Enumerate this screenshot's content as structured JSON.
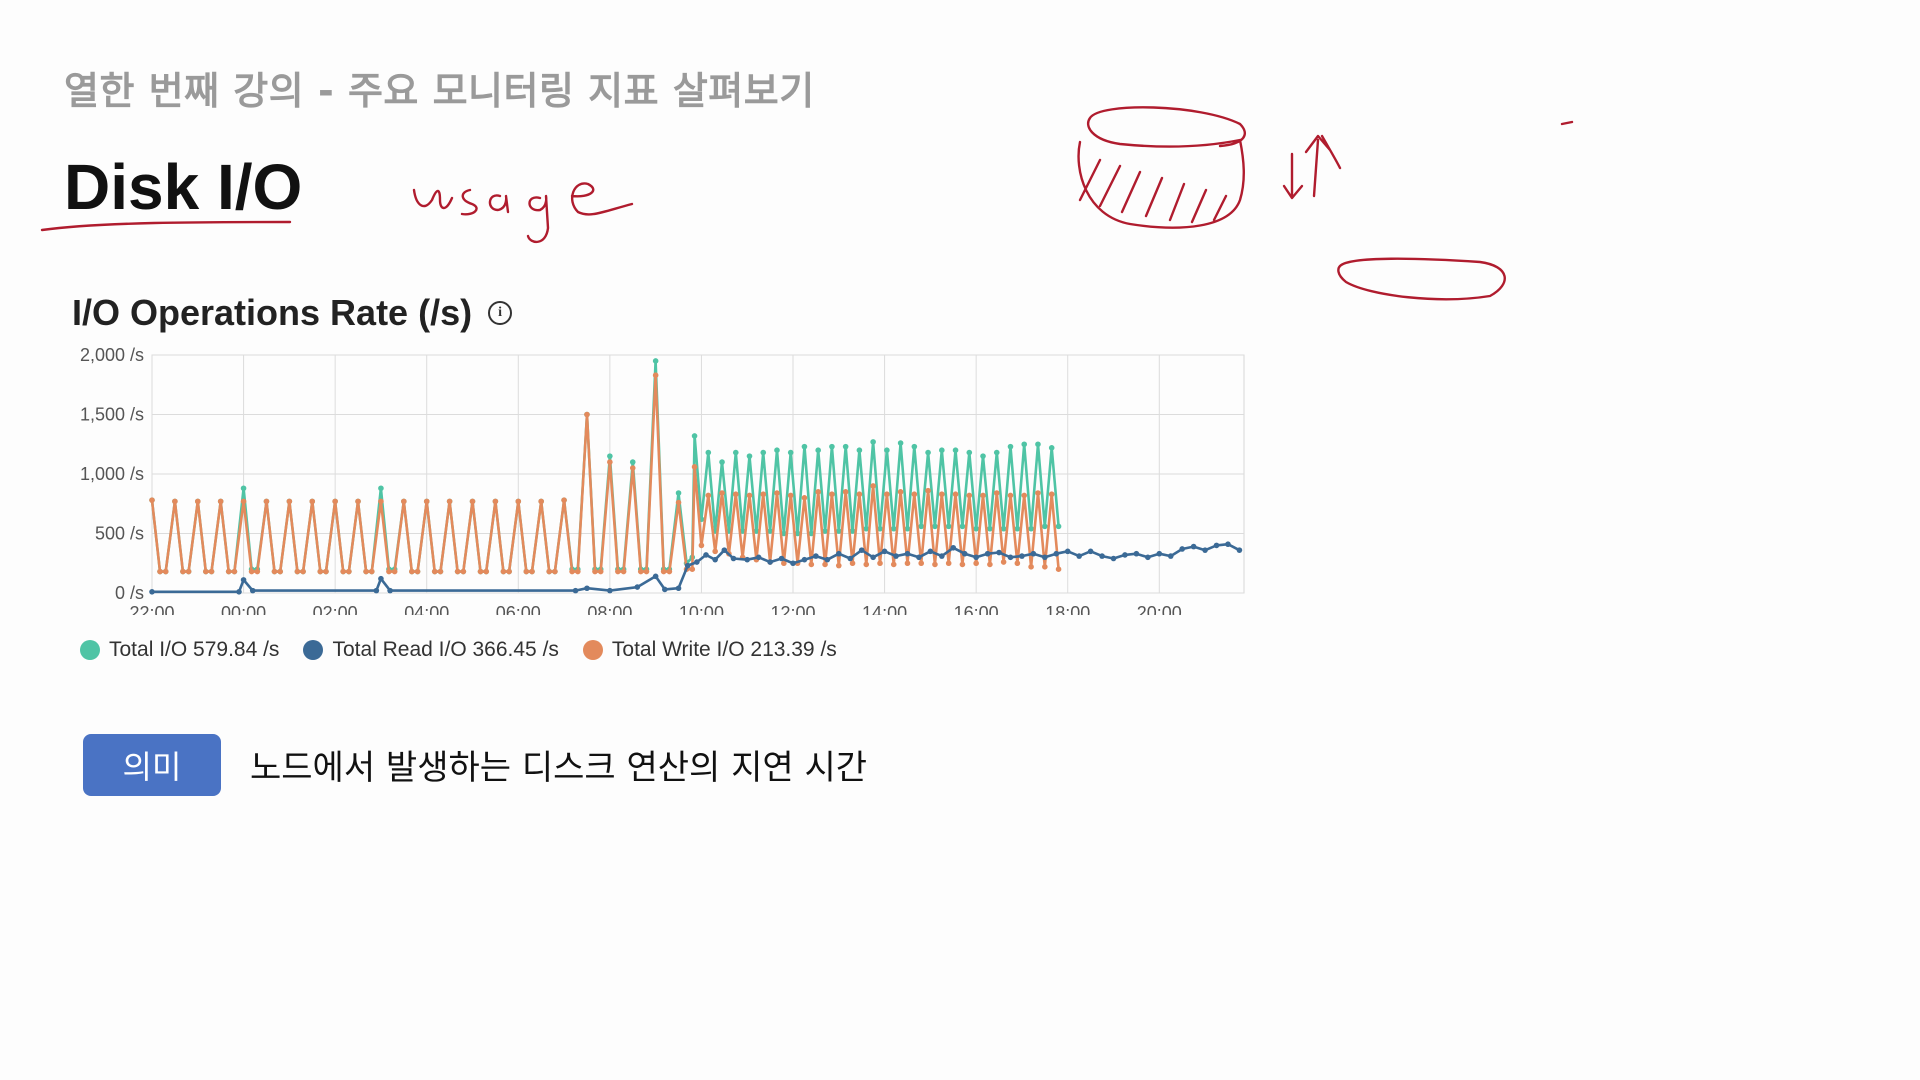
{
  "lecture": {
    "title": "열한 번째 강의 - 주요 모니터링 지표 살펴보기"
  },
  "section": {
    "title": "Disk I/O"
  },
  "meaning": {
    "badge": "의미",
    "text": "노드에서 발생하는 디스크 연산의 지연 시간"
  },
  "info_icon": "info-icon",
  "chart_data": {
    "type": "line",
    "title": "I/O Operations Rate (/s)",
    "x_tick_labels": [
      "22:00",
      "00:00",
      "02:00",
      "04:00",
      "06:00",
      "08:00",
      "10:00",
      "12:00",
      "14:00",
      "16:00",
      "18:00",
      "20:00"
    ],
    "y_tick_labels": [
      "0 /s",
      "500 /s",
      "1,000 /s",
      "1,500 /s",
      "2,000 /s"
    ],
    "ylim": [
      0,
      2000
    ],
    "x_range_hours": [
      0,
      24
    ],
    "grid": true,
    "legend_position": "bottom-left",
    "series": [
      {
        "name": "Total I/O",
        "legend_label": "Total I/O 579.84 /s",
        "color": "#4fc4a5",
        "points": [
          [
            0,
            780
          ],
          [
            0.35,
            180
          ],
          [
            0.6,
            180
          ],
          [
            1.0,
            770
          ],
          [
            1.35,
            180
          ],
          [
            1.6,
            180
          ],
          [
            2.0,
            770
          ],
          [
            2.35,
            180
          ],
          [
            2.6,
            180
          ],
          [
            3.0,
            770
          ],
          [
            3.35,
            180
          ],
          [
            3.6,
            180
          ],
          [
            4.0,
            880
          ],
          [
            4.35,
            200
          ],
          [
            4.6,
            200
          ],
          [
            5.0,
            770
          ],
          [
            5.35,
            180
          ],
          [
            5.6,
            180
          ],
          [
            6.0,
            770
          ],
          [
            6.35,
            180
          ],
          [
            6.6,
            180
          ],
          [
            7.0,
            770
          ],
          [
            7.35,
            180
          ],
          [
            7.6,
            180
          ],
          [
            8.0,
            770
          ],
          [
            8.35,
            180
          ],
          [
            8.6,
            180
          ],
          [
            9.0,
            770
          ],
          [
            9.35,
            180
          ],
          [
            9.6,
            180
          ],
          [
            10.0,
            880
          ],
          [
            10.35,
            200
          ],
          [
            10.6,
            200
          ],
          [
            11.0,
            770
          ],
          [
            11.35,
            180
          ],
          [
            11.6,
            180
          ],
          [
            12.0,
            770
          ],
          [
            12.35,
            180
          ],
          [
            12.6,
            180
          ],
          [
            13.0,
            770
          ],
          [
            13.35,
            180
          ],
          [
            13.6,
            180
          ],
          [
            14.0,
            770
          ],
          [
            14.35,
            180
          ],
          [
            14.6,
            180
          ],
          [
            15.0,
            770
          ],
          [
            15.35,
            180
          ],
          [
            15.6,
            180
          ],
          [
            16.0,
            770
          ],
          [
            16.35,
            180
          ],
          [
            16.6,
            180
          ],
          [
            17.0,
            770
          ],
          [
            17.35,
            180
          ],
          [
            17.6,
            180
          ],
          [
            18.0,
            780
          ],
          [
            18.35,
            200
          ],
          [
            18.6,
            200
          ],
          [
            19.0,
            1500
          ],
          [
            19.35,
            200
          ],
          [
            19.6,
            200
          ],
          [
            20.0,
            1150
          ],
          [
            20.35,
            200
          ],
          [
            20.6,
            200
          ],
          [
            21.0,
            1100
          ],
          [
            21.35,
            200
          ],
          [
            21.6,
            200
          ],
          [
            22.0,
            1950
          ],
          [
            22.35,
            200
          ],
          [
            22.6,
            200
          ],
          [
            23.0,
            840
          ],
          [
            23.35,
            250
          ],
          [
            23.6,
            300
          ],
          [
            23.7,
            1320
          ],
          [
            24.0,
            620
          ],
          [
            24.3,
            1180
          ],
          [
            24.6,
            520
          ],
          [
            24.9,
            1100
          ],
          [
            25.2,
            520
          ],
          [
            25.5,
            1180
          ],
          [
            25.8,
            520
          ],
          [
            26.1,
            1150
          ],
          [
            26.4,
            520
          ],
          [
            26.7,
            1180
          ],
          [
            27.0,
            520
          ],
          [
            27.3,
            1200
          ],
          [
            27.6,
            500
          ],
          [
            27.9,
            1180
          ],
          [
            28.2,
            500
          ],
          [
            28.5,
            1230
          ],
          [
            28.8,
            500
          ],
          [
            29.1,
            1200
          ],
          [
            29.4,
            520
          ],
          [
            29.7,
            1230
          ],
          [
            30.0,
            520
          ],
          [
            30.3,
            1230
          ],
          [
            30.6,
            520
          ],
          [
            30.9,
            1200
          ],
          [
            31.2,
            540
          ],
          [
            31.5,
            1270
          ],
          [
            31.8,
            540
          ],
          [
            32.1,
            1200
          ],
          [
            32.4,
            540
          ],
          [
            32.7,
            1260
          ],
          [
            33.0,
            540
          ],
          [
            33.3,
            1230
          ],
          [
            33.6,
            560
          ],
          [
            33.9,
            1180
          ],
          [
            34.2,
            560
          ],
          [
            34.5,
            1200
          ],
          [
            34.8,
            560
          ],
          [
            35.1,
            1200
          ],
          [
            35.4,
            560
          ],
          [
            35.7,
            1180
          ],
          [
            36.0,
            540
          ],
          [
            36.3,
            1150
          ],
          [
            36.6,
            540
          ],
          [
            36.9,
            1180
          ],
          [
            37.2,
            540
          ],
          [
            37.5,
            1230
          ],
          [
            37.8,
            540
          ],
          [
            38.1,
            1250
          ],
          [
            38.4,
            540
          ],
          [
            38.7,
            1250
          ],
          [
            39.0,
            560
          ],
          [
            39.3,
            1220
          ],
          [
            39.6,
            560
          ]
        ]
      },
      {
        "name": "Total Read I/O",
        "legend_label": "Total Read I/O 366.45 /s",
        "color": "#3b6a96",
        "points": [
          [
            0,
            10
          ],
          [
            3.8,
            10
          ],
          [
            4.0,
            110
          ],
          [
            4.4,
            20
          ],
          [
            9.8,
            20
          ],
          [
            10.0,
            120
          ],
          [
            10.4,
            20
          ],
          [
            18.5,
            20
          ],
          [
            19.0,
            40
          ],
          [
            20.0,
            20
          ],
          [
            21.2,
            50
          ],
          [
            22.0,
            140
          ],
          [
            22.4,
            30
          ],
          [
            23.0,
            40
          ],
          [
            23.4,
            230
          ],
          [
            23.8,
            260
          ],
          [
            24.2,
            320
          ],
          [
            24.6,
            280
          ],
          [
            25.0,
            360
          ],
          [
            25.4,
            290
          ],
          [
            26.0,
            280
          ],
          [
            26.5,
            300
          ],
          [
            27.0,
            260
          ],
          [
            27.5,
            290
          ],
          [
            28.0,
            250
          ],
          [
            28.5,
            280
          ],
          [
            29.0,
            310
          ],
          [
            29.5,
            280
          ],
          [
            30.0,
            330
          ],
          [
            30.5,
            290
          ],
          [
            31.0,
            360
          ],
          [
            31.5,
            300
          ],
          [
            32.0,
            350
          ],
          [
            32.5,
            310
          ],
          [
            33.0,
            330
          ],
          [
            33.5,
            300
          ],
          [
            34.0,
            350
          ],
          [
            34.5,
            310
          ],
          [
            35.0,
            380
          ],
          [
            35.5,
            330
          ],
          [
            36.0,
            300
          ],
          [
            36.5,
            330
          ],
          [
            37.0,
            340
          ],
          [
            37.5,
            300
          ],
          [
            38.0,
            310
          ],
          [
            38.5,
            330
          ],
          [
            39.0,
            300
          ],
          [
            39.5,
            330
          ],
          [
            40.0,
            350
          ],
          [
            40.5,
            310
          ],
          [
            41.0,
            350
          ],
          [
            41.5,
            310
          ],
          [
            42.0,
            290
          ],
          [
            42.5,
            320
          ],
          [
            43.0,
            330
          ],
          [
            43.5,
            300
          ],
          [
            44.0,
            330
          ],
          [
            44.5,
            310
          ],
          [
            45.0,
            370
          ],
          [
            45.5,
            390
          ],
          [
            46.0,
            360
          ],
          [
            46.5,
            400
          ],
          [
            47.0,
            410
          ],
          [
            47.5,
            360
          ]
        ]
      },
      {
        "name": "Total Write I/O",
        "legend_label": "Total Write I/O 213.39 /s",
        "color": "#e38a5c",
        "points": [
          [
            0,
            780
          ],
          [
            0.35,
            180
          ],
          [
            0.6,
            180
          ],
          [
            1.0,
            770
          ],
          [
            1.35,
            180
          ],
          [
            1.6,
            180
          ],
          [
            2.0,
            770
          ],
          [
            2.35,
            180
          ],
          [
            2.6,
            180
          ],
          [
            3.0,
            770
          ],
          [
            3.35,
            180
          ],
          [
            3.6,
            180
          ],
          [
            4.0,
            770
          ],
          [
            4.35,
            180
          ],
          [
            4.6,
            180
          ],
          [
            5.0,
            770
          ],
          [
            5.35,
            180
          ],
          [
            5.6,
            180
          ],
          [
            6.0,
            770
          ],
          [
            6.35,
            180
          ],
          [
            6.6,
            180
          ],
          [
            7.0,
            770
          ],
          [
            7.35,
            180
          ],
          [
            7.6,
            180
          ],
          [
            8.0,
            770
          ],
          [
            8.35,
            180
          ],
          [
            8.6,
            180
          ],
          [
            9.0,
            770
          ],
          [
            9.35,
            180
          ],
          [
            9.6,
            180
          ],
          [
            10.0,
            770
          ],
          [
            10.35,
            180
          ],
          [
            10.6,
            180
          ],
          [
            11.0,
            770
          ],
          [
            11.35,
            180
          ],
          [
            11.6,
            180
          ],
          [
            12.0,
            770
          ],
          [
            12.35,
            180
          ],
          [
            12.6,
            180
          ],
          [
            13.0,
            770
          ],
          [
            13.35,
            180
          ],
          [
            13.6,
            180
          ],
          [
            14.0,
            770
          ],
          [
            14.35,
            180
          ],
          [
            14.6,
            180
          ],
          [
            15.0,
            770
          ],
          [
            15.35,
            180
          ],
          [
            15.6,
            180
          ],
          [
            16.0,
            770
          ],
          [
            16.35,
            180
          ],
          [
            16.6,
            180
          ],
          [
            17.0,
            770
          ],
          [
            17.35,
            180
          ],
          [
            17.6,
            180
          ],
          [
            18.0,
            780
          ],
          [
            18.35,
            180
          ],
          [
            18.6,
            180
          ],
          [
            19.0,
            1500
          ],
          [
            19.35,
            180
          ],
          [
            19.6,
            180
          ],
          [
            20.0,
            1100
          ],
          [
            20.35,
            180
          ],
          [
            20.6,
            180
          ],
          [
            21.0,
            1050
          ],
          [
            21.35,
            180
          ],
          [
            21.6,
            180
          ],
          [
            22.0,
            1830
          ],
          [
            22.35,
            180
          ],
          [
            22.6,
            180
          ],
          [
            23.0,
            760
          ],
          [
            23.35,
            200
          ],
          [
            23.6,
            200
          ],
          [
            23.7,
            1060
          ],
          [
            24.0,
            400
          ],
          [
            24.3,
            820
          ],
          [
            24.6,
            350
          ],
          [
            24.9,
            840
          ],
          [
            25.2,
            330
          ],
          [
            25.5,
            830
          ],
          [
            25.8,
            300
          ],
          [
            26.1,
            820
          ],
          [
            26.4,
            280
          ],
          [
            26.7,
            830
          ],
          [
            27.0,
            260
          ],
          [
            27.3,
            840
          ],
          [
            27.6,
            250
          ],
          [
            27.9,
            820
          ],
          [
            28.2,
            250
          ],
          [
            28.5,
            800
          ],
          [
            28.8,
            240
          ],
          [
            29.1,
            850
          ],
          [
            29.4,
            240
          ],
          [
            29.7,
            830
          ],
          [
            30.0,
            230
          ],
          [
            30.3,
            850
          ],
          [
            30.6,
            250
          ],
          [
            30.9,
            830
          ],
          [
            31.2,
            240
          ],
          [
            31.5,
            900
          ],
          [
            31.8,
            250
          ],
          [
            32.1,
            830
          ],
          [
            32.4,
            240
          ],
          [
            32.7,
            850
          ],
          [
            33.0,
            250
          ],
          [
            33.3,
            830
          ],
          [
            33.6,
            250
          ],
          [
            33.9,
            860
          ],
          [
            34.2,
            240
          ],
          [
            34.5,
            830
          ],
          [
            34.8,
            250
          ],
          [
            35.1,
            830
          ],
          [
            35.4,
            240
          ],
          [
            35.7,
            820
          ],
          [
            36.0,
            250
          ],
          [
            36.3,
            820
          ],
          [
            36.6,
            240
          ],
          [
            36.9,
            840
          ],
          [
            37.2,
            260
          ],
          [
            37.5,
            820
          ],
          [
            37.8,
            250
          ],
          [
            38.1,
            820
          ],
          [
            38.4,
            220
          ],
          [
            38.7,
            840
          ],
          [
            39.0,
            220
          ],
          [
            39.3,
            830
          ],
          [
            39.6,
            200
          ]
        ]
      }
    ]
  }
}
